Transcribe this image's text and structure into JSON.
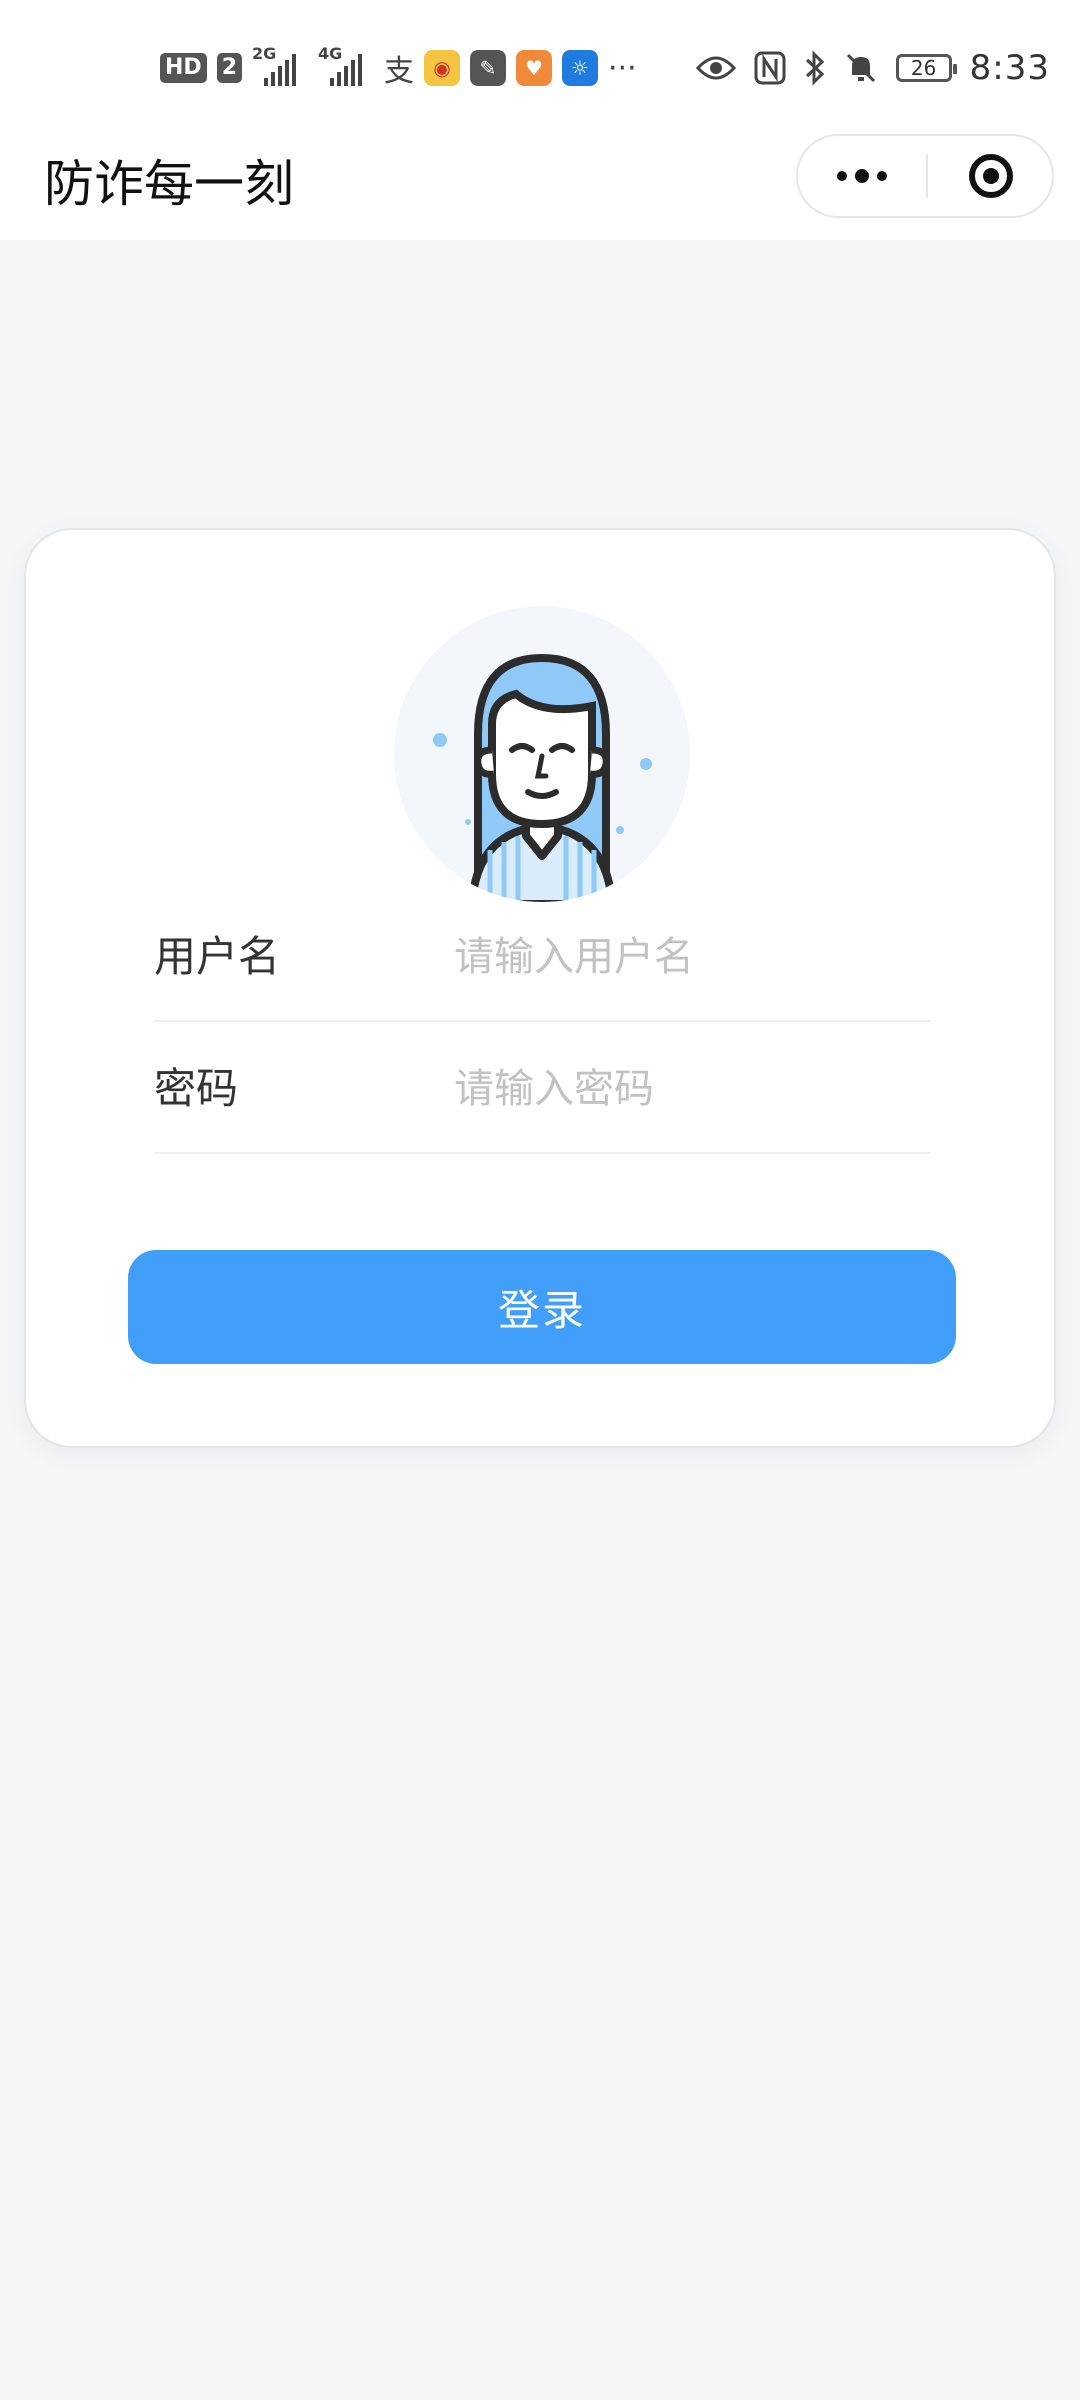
{
  "status_bar": {
    "hd_label": "HD",
    "sim_label": "2",
    "network_1": "2G",
    "network_2": "4G",
    "alipay_char": "支",
    "app_icons": [
      "weibo-icon",
      "feather-app-icon",
      "heart-app-icon",
      "lightbulb-app-icon"
    ],
    "more": "···",
    "battery": "26",
    "time": "8:33"
  },
  "nav": {
    "title": "防诈每一刻"
  },
  "login_form": {
    "username_label": "用户名",
    "username_placeholder": "请输入用户名",
    "password_label": "密码",
    "password_placeholder": "请输入密码",
    "submit_label": "登录"
  },
  "colors": {
    "primary": "#419ef9",
    "background": "#f5f6f8",
    "card": "#ffffff",
    "avatar_bg": "#f3f7fc",
    "hair": "#8ec9f7"
  }
}
